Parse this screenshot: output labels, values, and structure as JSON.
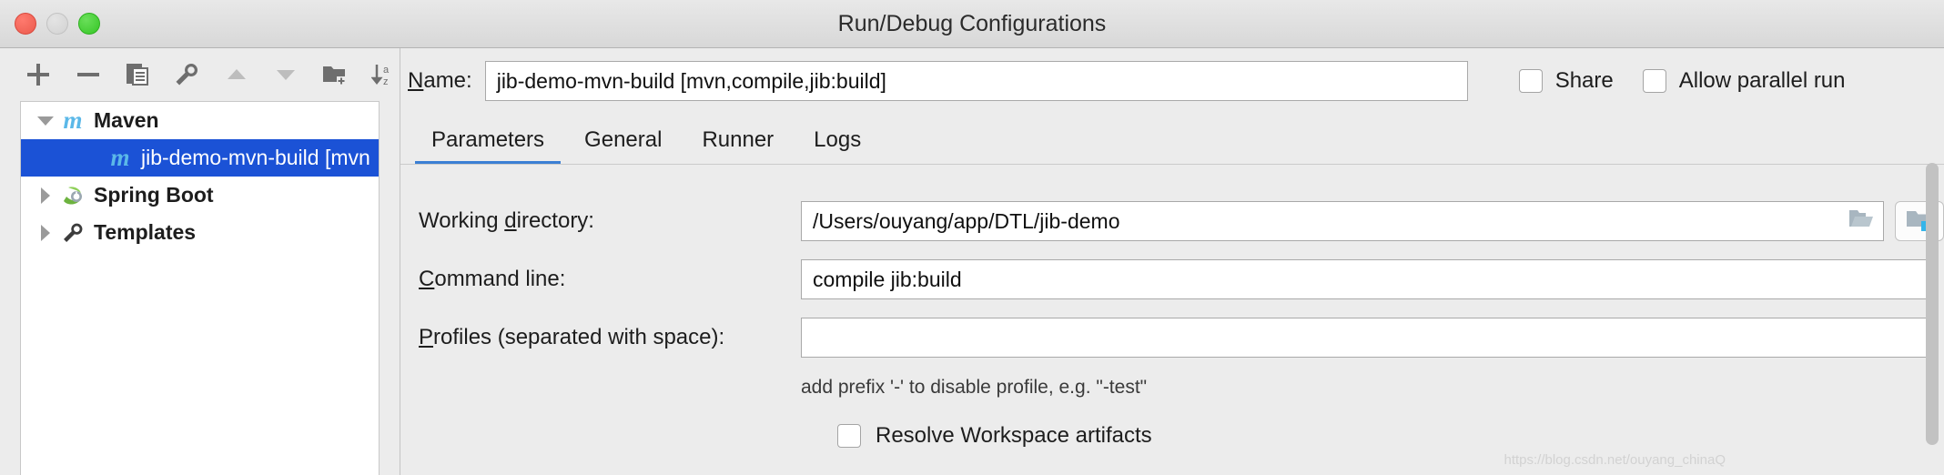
{
  "window": {
    "title": "Run/Debug Configurations",
    "traffic_lights": [
      "close-red",
      "minimize-yellow",
      "zoom-green"
    ]
  },
  "toolbar": {
    "buttons": [
      {
        "name": "add-icon",
        "label": "+"
      },
      {
        "name": "remove-icon",
        "label": "−"
      },
      {
        "name": "copy-icon",
        "label": "Copy Configuration"
      },
      {
        "name": "edit-templates-icon",
        "label": "Edit Templates"
      },
      {
        "name": "move-up-icon",
        "label": "Move Up"
      },
      {
        "name": "move-down-icon",
        "label": "Move Down"
      },
      {
        "name": "new-folder-icon",
        "label": "New Folder"
      },
      {
        "name": "sort-alphabetically-icon",
        "label": "Sort Alphabetically"
      }
    ]
  },
  "sidebar": {
    "items": [
      {
        "label": "Maven",
        "icon": "maven-m-icon",
        "expanded": true,
        "selected": false,
        "child": false
      },
      {
        "label": "jib-demo-mvn-build [mvn",
        "icon": "maven-m-icon",
        "expanded": false,
        "selected": true,
        "child": true
      },
      {
        "label": "Spring Boot",
        "icon": "spring-boot-leaf-icon",
        "expanded": false,
        "selected": false,
        "child": false
      },
      {
        "label": "Templates",
        "icon": "wrench-icon",
        "expanded": false,
        "selected": false,
        "child": false
      }
    ]
  },
  "header": {
    "name_label": "Name:",
    "name_label_mnemonic": "N",
    "name_value": "jib-demo-mvn-build [mvn,compile,jib:build]",
    "share_label": "Share",
    "share_checked": false,
    "allow_parallel_label": "Allow parallel run",
    "allow_parallel_checked": false
  },
  "tabs": [
    {
      "label": "Parameters",
      "active": true
    },
    {
      "label": "General",
      "active": false
    },
    {
      "label": "Runner",
      "active": false
    },
    {
      "label": "Logs",
      "active": false
    }
  ],
  "form": {
    "working_directory": {
      "label_pre": "Working ",
      "label_mnemonic": "d",
      "label_post": "irectory:",
      "value": "/Users/ouyang/app/DTL/jib-demo"
    },
    "command_line": {
      "label_mnemonic": "C",
      "label_post": "ommand line:",
      "value": "compile jib:build"
    },
    "profiles": {
      "label_mnemonic": "P",
      "label_post": "rofiles (separated with space):",
      "value": "",
      "hint": "add prefix '-' to disable profile, e.g. \"-test\""
    },
    "resolve_workspace": {
      "label": "Resolve Workspace artifacts",
      "checked": false
    }
  },
  "colors": {
    "selection_blue": "#1b52d6",
    "tab_accent": "#3b7fd4",
    "maven_icon_blue": "#5bb8e8",
    "spring_green": "#6db33f",
    "panel_bg": "#ececec"
  },
  "watermark": "https://blog.csdn.net/ouyang_chinaQ"
}
